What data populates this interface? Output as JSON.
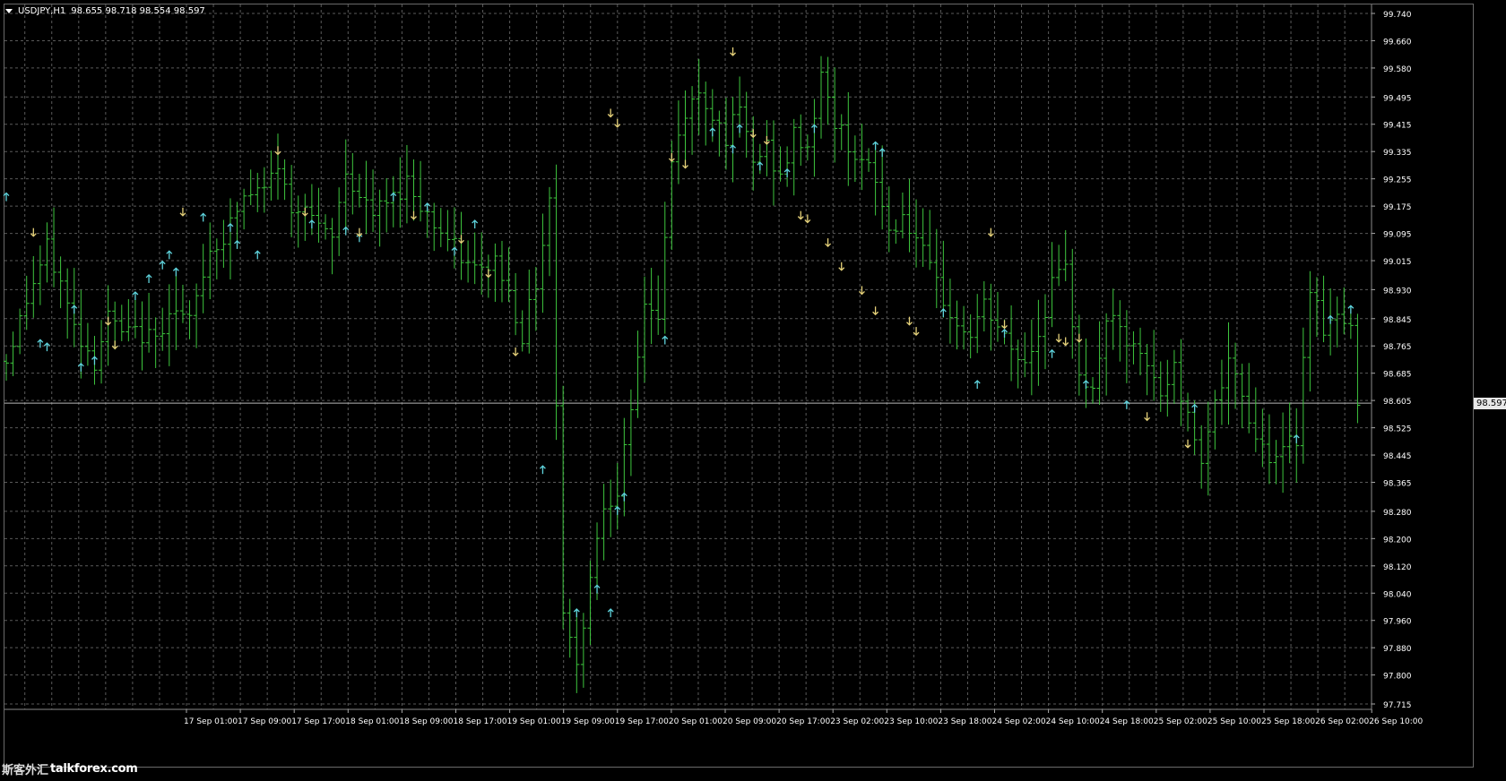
{
  "header": {
    "symbol": "USDJPY,H1",
    "ohlc": "98.655 98.718 98.554 98.597"
  },
  "current_price": "98.597",
  "colors": {
    "background": "#000000",
    "bars": "#3ec63e",
    "grid": "#5a5a5a",
    "up_arrow": "#5fd3dc",
    "down_arrow": "#e6d27a",
    "price_line": "#b8b8b8",
    "axis_text": "#ffffff"
  },
  "watermark": {
    "cjk": "斯客外汇",
    "url": "talkforex.com"
  },
  "chart_data": {
    "type": "ohlc-bar",
    "symbol": "USDJPY",
    "timeframe": "H1",
    "y_ticks": [
      "99.740",
      "99.660",
      "99.580",
      "99.495",
      "99.415",
      "99.335",
      "99.255",
      "99.175",
      "99.095",
      "99.015",
      "98.930",
      "98.845",
      "98.765",
      "98.685",
      "98.605",
      "98.525",
      "98.445",
      "98.365",
      "98.280",
      "98.200",
      "98.120",
      "98.040",
      "97.960",
      "97.880",
      "97.800",
      "97.715"
    ],
    "x_ticks": [
      "17 Sep 01:00",
      "17 Sep 09:00",
      "17 Sep 17:00",
      "18 Sep 01:00",
      "18 Sep 09:00",
      "18 Sep 17:00",
      "19 Sep 01:00",
      "19 Sep 09:00",
      "19 Sep 17:00",
      "20 Sep 01:00",
      "20 Sep 09:00",
      "20 Sep 17:00",
      "23 Sep 02:00",
      "23 Sep 10:00",
      "23 Sep 18:00",
      "24 Sep 02:00",
      "24 Sep 10:00",
      "24 Sep 18:00",
      "25 Sep 02:00",
      "25 Sep 10:00",
      "25 Sep 18:00",
      "26 Sep 02:00",
      "26 Sep 10:00"
    ],
    "ylim": [
      97.7,
      99.75
    ],
    "current_price": 98.597,
    "close_path": [
      [
        0,
        98.72
      ],
      [
        3,
        98.9
      ],
      [
        6,
        99.05
      ],
      [
        8,
        98.95
      ],
      [
        10,
        98.82
      ],
      [
        13,
        98.72
      ],
      [
        15,
        98.85
      ],
      [
        17,
        98.8
      ],
      [
        20,
        98.8
      ],
      [
        22,
        98.78
      ],
      [
        24,
        98.88
      ],
      [
        27,
        98.83
      ],
      [
        30,
        99.05
      ],
      [
        32,
        99.08
      ],
      [
        35,
        99.2
      ],
      [
        38,
        99.22
      ],
      [
        40,
        99.3
      ],
      [
        42,
        99.15
      ],
      [
        44,
        99.2
      ],
      [
        46,
        99.1
      ],
      [
        48,
        99.08
      ],
      [
        50,
        99.28
      ],
      [
        52,
        99.2
      ],
      [
        54,
        99.15
      ],
      [
        57,
        99.2
      ],
      [
        59,
        99.25
      ],
      [
        62,
        99.15
      ],
      [
        64,
        99.1
      ],
      [
        66,
        99.05
      ],
      [
        68,
        99.0
      ],
      [
        70,
        98.98
      ],
      [
        72,
        99.02
      ],
      [
        74,
        98.92
      ],
      [
        76,
        98.8
      ],
      [
        78,
        98.95
      ],
      [
        80,
        99.2
      ],
      [
        82,
        98.0
      ],
      [
        84,
        97.82
      ],
      [
        86,
        98.1
      ],
      [
        88,
        98.3
      ],
      [
        90,
        98.35
      ],
      [
        92,
        98.55
      ],
      [
        94,
        98.9
      ],
      [
        96,
        98.85
      ],
      [
        98,
        99.3
      ],
      [
        100,
        99.45
      ],
      [
        102,
        99.5
      ],
      [
        104,
        99.45
      ],
      [
        106,
        99.38
      ],
      [
        108,
        99.45
      ],
      [
        110,
        99.3
      ],
      [
        112,
        99.35
      ],
      [
        114,
        99.25
      ],
      [
        116,
        99.38
      ],
      [
        118,
        99.35
      ],
      [
        120,
        99.55
      ],
      [
        122,
        99.42
      ],
      [
        124,
        99.36
      ],
      [
        126,
        99.3
      ],
      [
        128,
        99.25
      ],
      [
        130,
        99.1
      ],
      [
        132,
        99.15
      ],
      [
        134,
        99.08
      ],
      [
        136,
        98.98
      ],
      [
        138,
        98.9
      ],
      [
        140,
        98.82
      ],
      [
        142,
        98.8
      ],
      [
        144,
        98.88
      ],
      [
        146,
        98.82
      ],
      [
        148,
        98.75
      ],
      [
        150,
        98.72
      ],
      [
        152,
        98.8
      ],
      [
        154,
        98.95
      ],
      [
        156,
        98.98
      ],
      [
        158,
        98.7
      ],
      [
        160,
        98.62
      ],
      [
        162,
        98.85
      ],
      [
        164,
        98.8
      ],
      [
        166,
        98.75
      ],
      [
        168,
        98.7
      ],
      [
        170,
        98.62
      ],
      [
        172,
        98.7
      ],
      [
        174,
        98.55
      ],
      [
        176,
        98.45
      ],
      [
        178,
        98.6
      ],
      [
        180,
        98.7
      ],
      [
        182,
        98.62
      ],
      [
        184,
        98.5
      ],
      [
        186,
        98.45
      ],
      [
        188,
        98.45
      ],
      [
        190,
        98.5
      ],
      [
        192,
        98.95
      ],
      [
        194,
        98.82
      ],
      [
        196,
        98.85
      ],
      [
        198,
        98.8
      ],
      [
        199,
        98.62
      ]
    ],
    "up_arrows": [
      [
        0,
        99.2
      ],
      [
        5,
        98.77
      ],
      [
        6,
        98.76
      ],
      [
        10,
        98.87
      ],
      [
        11,
        98.7
      ],
      [
        13,
        98.72
      ],
      [
        19,
        98.91
      ],
      [
        21,
        98.96
      ],
      [
        23,
        99.0
      ],
      [
        24,
        99.03
      ],
      [
        25,
        98.98
      ],
      [
        29,
        99.14
      ],
      [
        33,
        99.11
      ],
      [
        34,
        99.06
      ],
      [
        37,
        99.03
      ],
      [
        45,
        99.12
      ],
      [
        50,
        99.1
      ],
      [
        52,
        99.08
      ],
      [
        57,
        99.2
      ],
      [
        62,
        99.17
      ],
      [
        66,
        99.04
      ],
      [
        69,
        99.12
      ],
      [
        79,
        98.4
      ],
      [
        84,
        97.98
      ],
      [
        87,
        98.05
      ],
      [
        89,
        97.98
      ],
      [
        90,
        98.28
      ],
      [
        91,
        98.32
      ],
      [
        97,
        98.78
      ],
      [
        104,
        99.39
      ],
      [
        107,
        99.34
      ],
      [
        108,
        99.4
      ],
      [
        111,
        99.29
      ],
      [
        115,
        99.27
      ],
      [
        119,
        99.4
      ],
      [
        128,
        99.35
      ],
      [
        129,
        99.33
      ],
      [
        138,
        98.86
      ],
      [
        143,
        98.65
      ],
      [
        147,
        98.8
      ],
      [
        154,
        98.74
      ],
      [
        159,
        98.65
      ],
      [
        165,
        98.59
      ],
      [
        175,
        98.58
      ],
      [
        190,
        98.49
      ],
      [
        195,
        98.84
      ],
      [
        198,
        98.87
      ]
    ],
    "down_arrows": [
      [
        4,
        99.1
      ],
      [
        15,
        98.84
      ],
      [
        16,
        98.77
      ],
      [
        26,
        99.16
      ],
      [
        40,
        99.34
      ],
      [
        44,
        99.16
      ],
      [
        52,
        99.1
      ],
      [
        60,
        99.15
      ],
      [
        67,
        99.08
      ],
      [
        71,
        98.98
      ],
      [
        75,
        98.75
      ],
      [
        89,
        99.45
      ],
      [
        90,
        99.42
      ],
      [
        98,
        99.32
      ],
      [
        100,
        99.3
      ],
      [
        107,
        99.63
      ],
      [
        110,
        99.39
      ],
      [
        112,
        99.37
      ],
      [
        117,
        99.15
      ],
      [
        118,
        99.14
      ],
      [
        121,
        99.07
      ],
      [
        123,
        99.0
      ],
      [
        126,
        98.93
      ],
      [
        128,
        98.87
      ],
      [
        133,
        98.84
      ],
      [
        134,
        98.81
      ],
      [
        145,
        99.1
      ],
      [
        147,
        98.83
      ],
      [
        155,
        98.79
      ],
      [
        156,
        98.78
      ],
      [
        158,
        98.79
      ],
      [
        168,
        98.56
      ],
      [
        174,
        98.48
      ]
    ]
  }
}
